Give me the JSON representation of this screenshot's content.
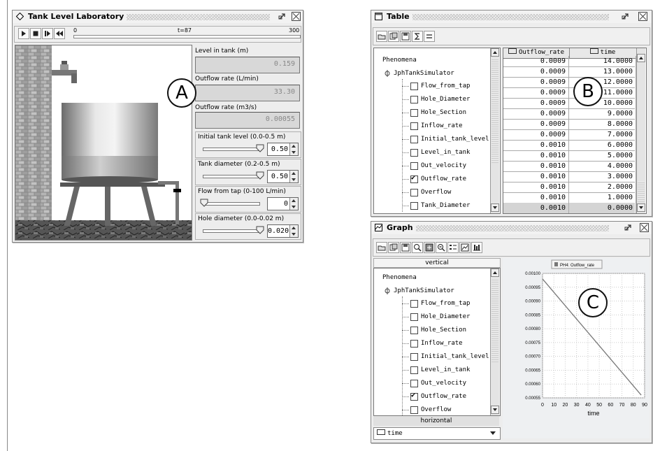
{
  "window_a": {
    "title": "Tank Level Laboratory",
    "timeline": {
      "start": "0",
      "current": "t=87",
      "end": "300"
    },
    "level_label": "Level in tank (m)",
    "level_value": "0.159",
    "outflow_lmin_label": "Outflow rate (L/min)",
    "outflow_lmin_value": "33.30",
    "outflow_m3s_label": "Outflow rate (m3/s)",
    "outflow_m3s_value": "0.00055",
    "controls": [
      {
        "label": "Initial tank level (0.0-0.5 m)",
        "value": "0.50",
        "level": 1.0
      },
      {
        "label": "Tank diameter (0.2-0.5 m)",
        "value": "0.50",
        "level": 1.0
      },
      {
        "label": "Flow from tap (0-100 L/min)",
        "value": "0",
        "level": 0.0
      },
      {
        "label": "Hole diameter (0.0-0.02 m)",
        "value": "0.020",
        "level": 1.0
      }
    ],
    "marker": "A"
  },
  "window_b": {
    "title": "Table",
    "tree": {
      "root": "Phenomena",
      "node": "JphTankSimulator",
      "items": [
        {
          "label": "Flow_from_tap",
          "checked": false
        },
        {
          "label": "Hole_Diameter",
          "checked": false
        },
        {
          "label": "Hole_Section",
          "checked": false
        },
        {
          "label": "Inflow_rate",
          "checked": false
        },
        {
          "label": "Initial_tank_level",
          "checked": false
        },
        {
          "label": "Level_in_tank",
          "checked": false
        },
        {
          "label": "Out_velocity",
          "checked": false
        },
        {
          "label": "Outflow_rate",
          "checked": true
        },
        {
          "label": "Overflow",
          "checked": false
        },
        {
          "label": "Tank_Diameter",
          "checked": false
        }
      ]
    },
    "columns": [
      "Outflow_rate",
      "time"
    ],
    "rows": [
      [
        "0.0009",
        "14.0000"
      ],
      [
        "0.0009",
        "13.0000"
      ],
      [
        "0.0009",
        "12.0000"
      ],
      [
        "0.0009",
        "11.0000"
      ],
      [
        "0.0009",
        "10.0000"
      ],
      [
        "0.0009",
        "9.0000"
      ],
      [
        "0.0009",
        "8.0000"
      ],
      [
        "0.0009",
        "7.0000"
      ],
      [
        "0.0010",
        "6.0000"
      ],
      [
        "0.0010",
        "5.0000"
      ],
      [
        "0.0010",
        "4.0000"
      ],
      [
        "0.0010",
        "3.0000"
      ],
      [
        "0.0010",
        "2.0000"
      ],
      [
        "0.0010",
        "1.0000"
      ],
      [
        "0.0010",
        "0.0000"
      ]
    ],
    "marker": "B"
  },
  "window_c": {
    "title": "Graph",
    "vertical_label": "vertical",
    "horizontal_label": "horizontal",
    "horizontal_select": "time",
    "tree": {
      "root": "Phenomena",
      "node": "JphTankSimulator",
      "items": [
        {
          "label": "Flow_from_tap",
          "checked": false
        },
        {
          "label": "Hole_Diameter",
          "checked": false
        },
        {
          "label": "Hole_Section",
          "checked": false
        },
        {
          "label": "Inflow_rate",
          "checked": false
        },
        {
          "label": "Initial_tank_level",
          "checked": false
        },
        {
          "label": "Level_in_tank",
          "checked": false
        },
        {
          "label": "Out_velocity",
          "checked": false
        },
        {
          "label": "Outflow_rate",
          "checked": true
        },
        {
          "label": "Overflow",
          "checked": false
        }
      ]
    },
    "marker": "C"
  },
  "chart_data": {
    "type": "line",
    "legend": "PH4: Outflow_rate",
    "xlabel": "time",
    "ylabel": "",
    "xlim": [
      0,
      90
    ],
    "ylim": [
      0.00055,
      0.001
    ],
    "xticks": [
      "0",
      "10",
      "20",
      "30",
      "40",
      "50",
      "60",
      "70",
      "80",
      "90"
    ],
    "yticks": [
      "0.00100",
      "0.00095",
      "0.00090",
      "0.00085",
      "0.00080",
      "0.00075",
      "0.00070",
      "0.00065",
      "0.00060",
      "0.00055"
    ],
    "grid": true,
    "series": [
      {
        "name": "PH4: Outflow_rate",
        "x": [
          0,
          87
        ],
        "y": [
          0.00098,
          0.00056
        ]
      }
    ]
  }
}
